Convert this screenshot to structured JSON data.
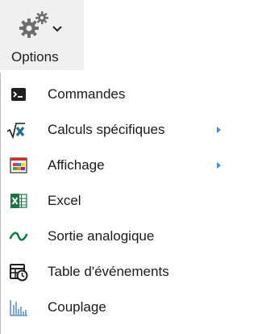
{
  "ribbon": {
    "button_label": "Options",
    "icon": "gears-icon",
    "dropdown_icon": "chevron-down-icon"
  },
  "menu": {
    "items": [
      {
        "label": "Commandes",
        "icon": "command-prompt-icon",
        "has_submenu": false
      },
      {
        "label": "Calculs spécifiques",
        "icon": "sqrt-x-icon",
        "has_submenu": true
      },
      {
        "label": "Affichage",
        "icon": "display-window-icon",
        "has_submenu": true
      },
      {
        "label": "Excel",
        "icon": "excel-icon",
        "has_submenu": false
      },
      {
        "label": "Sortie analogique",
        "icon": "wave-icon",
        "has_submenu": false
      },
      {
        "label": "Table d'événements",
        "icon": "event-table-icon",
        "has_submenu": false
      },
      {
        "label": "Couplage",
        "icon": "coupling-bars-icon",
        "has_submenu": false
      }
    ]
  },
  "colors": {
    "ribbon_bg": "#f0f0f0",
    "submenu_arrow": "#3c8fd6",
    "excel_green": "#1e7145",
    "wave_green": "#107c41",
    "coupling_blue": "#2f6fbf"
  }
}
